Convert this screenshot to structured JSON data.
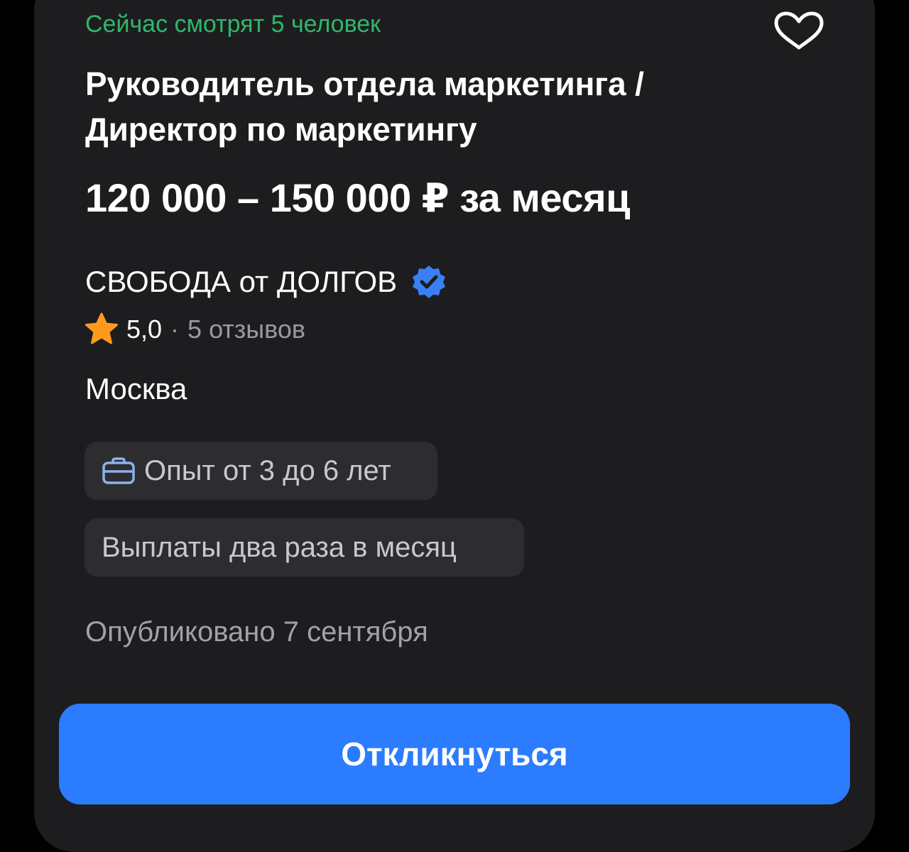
{
  "vacancy": {
    "viewers_text": "Сейчас смотрят 5 человек",
    "title": "Руководитель отдела маркетинга / Директор по маркетингу",
    "salary": "120 000 – 150 000 ₽ за месяц",
    "company": {
      "name": "СВОБОДА от ДОЛГОВ",
      "verified_icon": "verified-badge-icon",
      "rating": "5,0",
      "separator": "·",
      "reviews": "5 отзывов"
    },
    "city": "Москва",
    "tags": {
      "experience": "Опыт от 3 до 6 лет",
      "payments": "Выплаты два раза в месяц"
    },
    "published": "Опубликовано 7 сентября"
  },
  "actions": {
    "respond_label": "Откликнуться",
    "favorite_icon": "heart-icon"
  },
  "colors": {
    "accent_blue": "#2b7cff",
    "viewers_green": "#2fb76c",
    "star_orange": "#ff9a1f",
    "verified_blue": "#3b7ff5",
    "card_bg": "#1d1d1f",
    "chip_bg": "#2d2d30"
  }
}
